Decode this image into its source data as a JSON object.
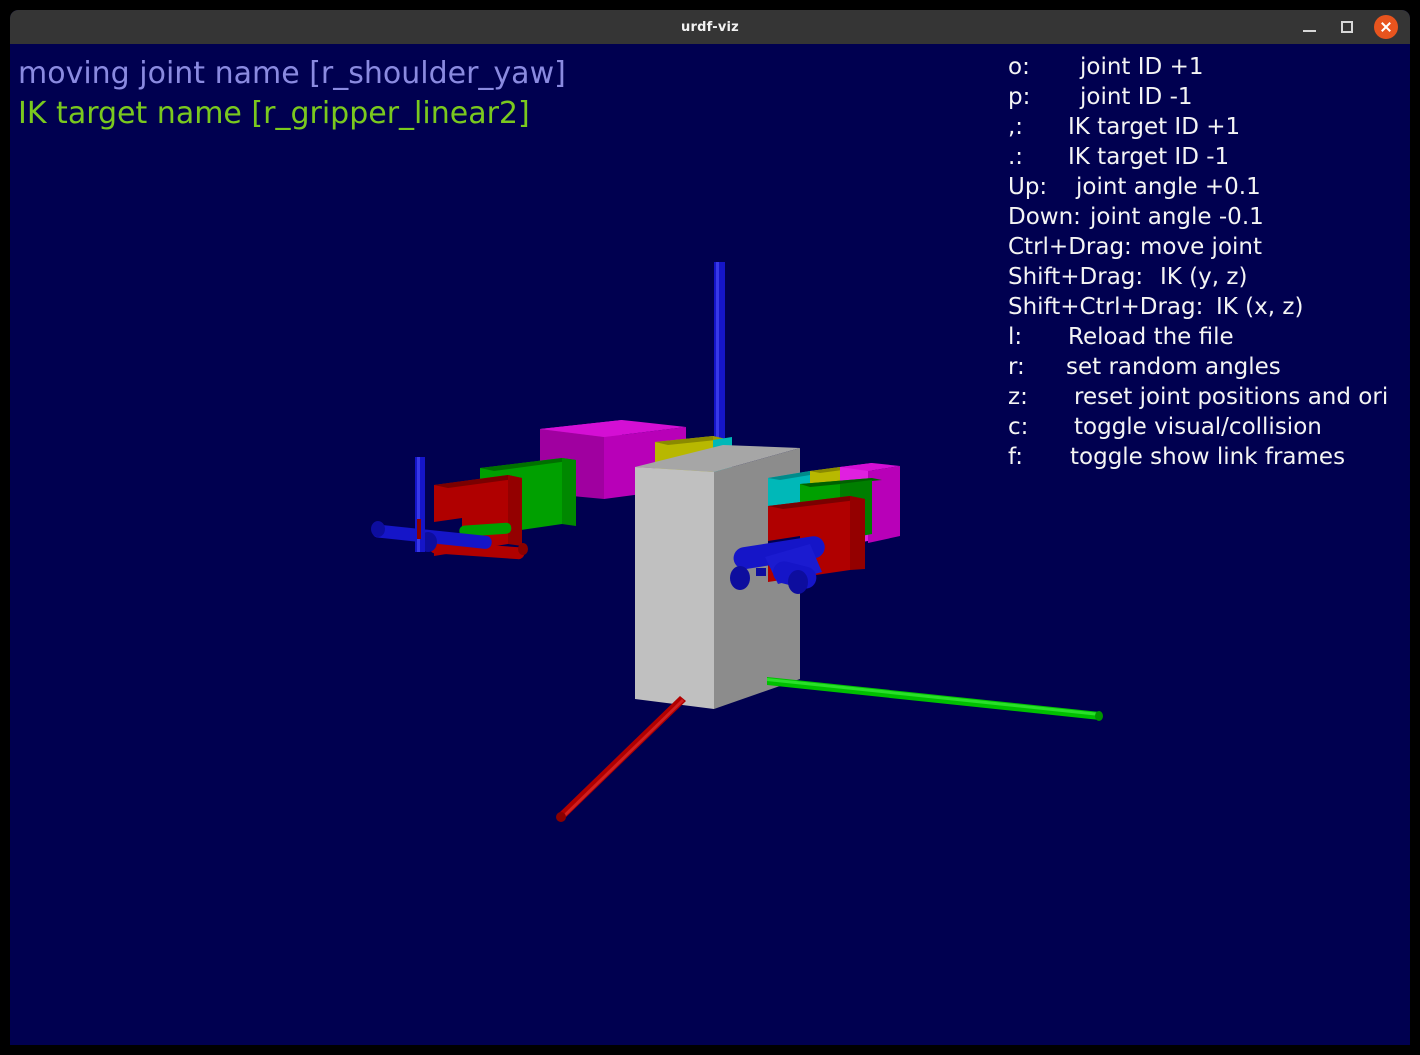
{
  "window": {
    "title": "urdf-viz",
    "minimize_label": "minimize",
    "maximize_label": "maximize",
    "close_label": "close"
  },
  "status": {
    "joint_line": "moving joint name [r_shoulder_yaw]",
    "ik_line": "IK target name [r_gripper_linear2]",
    "joint_color": "#8a8ae0",
    "ik_color": "#7ac91e"
  },
  "help": {
    "rows": [
      {
        "key": "o:",
        "key_w": 72,
        "desc": "joint ID +1"
      },
      {
        "key": "p:",
        "key_w": 72,
        "desc": "joint ID -1"
      },
      {
        "key": ",:",
        "key_w": 60,
        "desc": "IK target ID +1"
      },
      {
        "key": ".:",
        "key_w": 60,
        "desc": "IK target ID -1"
      },
      {
        "key": "Up:",
        "key_w": 68,
        "desc": "joint angle +0.1"
      },
      {
        "key": "Down:",
        "key_w": 82,
        "desc": "joint angle -0.1"
      },
      {
        "key": "Ctrl+Drag:",
        "key_w": 132,
        "desc": "move joint"
      },
      {
        "key": "Shift+Drag:",
        "key_w": 152,
        "desc": "IK (y, z)"
      },
      {
        "key": "Shift+Ctrl+Drag:",
        "key_w": 208,
        "desc": "IK (x, z)"
      },
      {
        "key": "l:",
        "key_w": 60,
        "desc": "Reload the file"
      },
      {
        "key": "r:",
        "key_w": 58,
        "desc": "set random angles"
      },
      {
        "key": "z:",
        "key_w": 66,
        "desc": "reset joint positions and ori"
      },
      {
        "key": "c:",
        "key_w": 66,
        "desc": "toggle visual/collision"
      },
      {
        "key": "f:",
        "key_w": 62,
        "desc": "toggle show link frames"
      }
    ]
  },
  "scene": {
    "background_color": "#000050",
    "description": "urdf-viz 3D robot torso with two arms and world coordinate frame",
    "world_axes": {
      "x_color": "#b00000",
      "y_color": "#00c000",
      "z_color": "#1515c8"
    },
    "link_colors": {
      "torso_front": "#c0c0c0",
      "torso_side": "#8c8c8c",
      "torso_top": "#a6a6a6",
      "magenta": "#b800b8",
      "magenta_light": "#e020e0",
      "green": "#00a000",
      "green_dark": "#006000",
      "yellow": "#b8b800",
      "yellow_dark": "#8a8a00",
      "cyan": "#00b8b8",
      "cyan_dark": "#008a8a",
      "red": "#b00000",
      "red_dark": "#7a0000",
      "blue": "#1515c8",
      "blue_dark": "#0b0b8c"
    }
  }
}
